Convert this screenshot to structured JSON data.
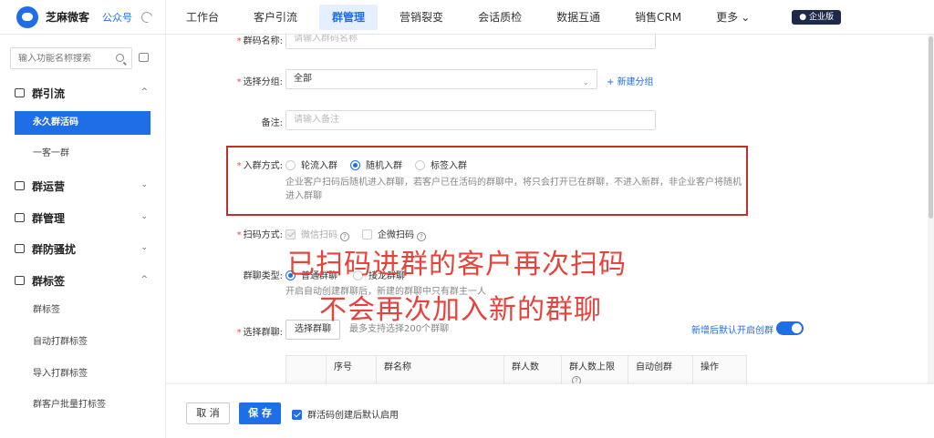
{
  "brand": {
    "name": "芝麻微客",
    "sub": "公众号"
  },
  "nav": {
    "items": [
      "工作台",
      "客户引流",
      "群管理",
      "营销裂变",
      "会话质检",
      "数据互通",
      "销售CRM",
      "更多"
    ],
    "active_index": 2,
    "badge": "企业版"
  },
  "sidebar": {
    "search_placeholder": "输入功能名称搜索",
    "groups": [
      {
        "label": "群引流",
        "expanded": true,
        "items": [
          "永久群活码",
          "一客一群"
        ],
        "active": "永久群活码"
      },
      {
        "label": "群运营",
        "expanded": false
      },
      {
        "label": "群管理",
        "expanded": false
      },
      {
        "label": "群防骚扰",
        "expanded": false
      },
      {
        "label": "群标签",
        "expanded": true,
        "items": [
          "群标签",
          "自动打群标签",
          "导入打群标签",
          "群客户批量打标签"
        ]
      }
    ]
  },
  "form": {
    "name": {
      "label": "群码名称:",
      "placeholder": "请输入群码名称"
    },
    "group": {
      "label": "选择分组:",
      "value": "全部",
      "add_link": "新建分组"
    },
    "remark": {
      "label": "备注:",
      "placeholder": "请输入备注"
    },
    "join_mode": {
      "label": "入群方式:",
      "options": [
        "轮流入群",
        "随机入群",
        "标签入群"
      ],
      "selected": "随机入群",
      "desc_line1": "企业客户扫码后随机进入群聊，若客户已在活码的群聊中，将只会打开已在群聊，不进入新群，非企业客户将随机",
      "desc_line2": "进入群聊"
    },
    "scan_mode": {
      "label": "扫码方式:",
      "options": [
        "微信扫码",
        "企微扫码"
      ]
    },
    "chat_type": {
      "label": "群聊类型:",
      "options": [
        "普通群聊",
        "接龙群聊"
      ],
      "desc": "开启自动创建群聊后，新建的群聊中只有群主一人"
    },
    "select_chat": {
      "label": "选择群聊:",
      "button": "选择群聊",
      "hint": "最多支持选择200个群聊",
      "auto_create_link": "新增后默认开启创群"
    },
    "table_headers": [
      "序号",
      "群名称",
      "群人数",
      "群人数上限",
      "自动创群",
      "操作"
    ]
  },
  "overlay": {
    "line1": "已扫码进群的客户再次扫码",
    "line2": "不会再次加入新的群聊"
  },
  "footer": {
    "cancel": "取 消",
    "save": "保 存",
    "default_enable": "群活码创建后默认启用"
  },
  "colors": {
    "accent": "#1e6ee8",
    "highlight": "#c0302a",
    "overlay_text": "#e8423b"
  }
}
